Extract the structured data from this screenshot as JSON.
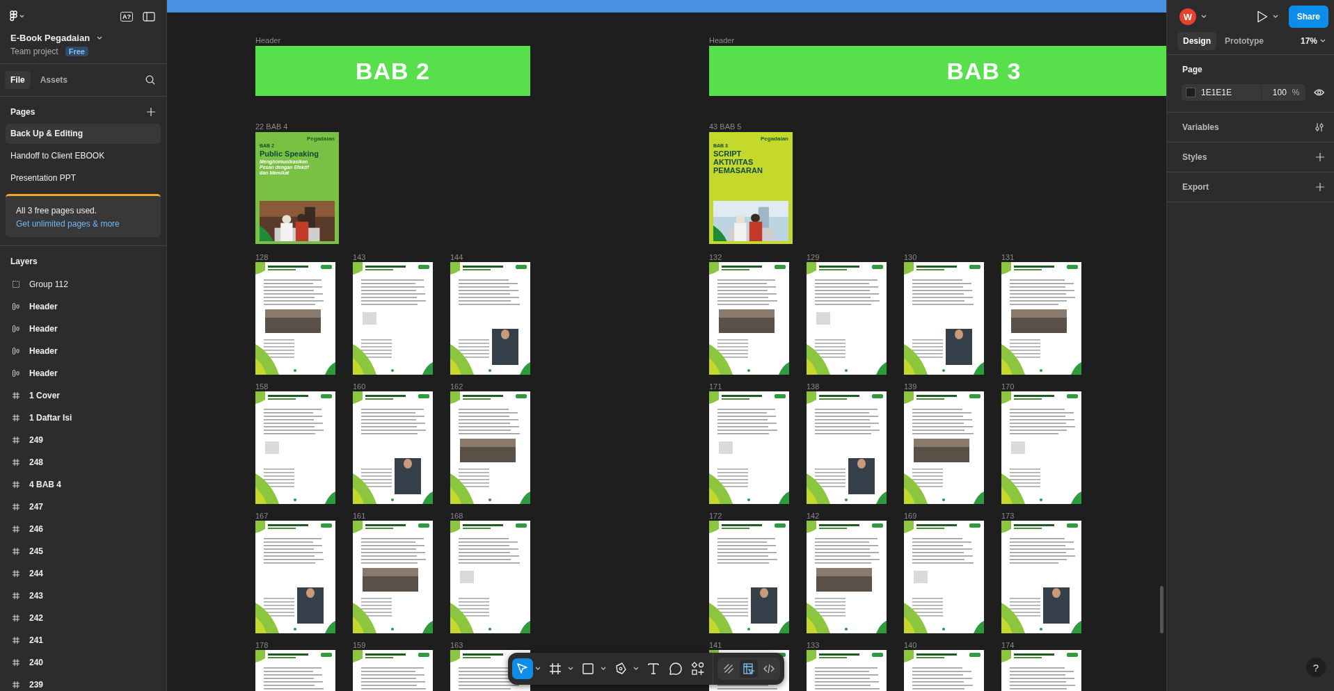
{
  "left_panel": {
    "project": {
      "name": "E-Book Pegadaian",
      "team": "Team project",
      "plan": "Free"
    },
    "ai_badge": "A?",
    "tabs": [
      {
        "label": "File",
        "selected": true
      },
      {
        "label": "Assets",
        "selected": false
      }
    ],
    "pages_title": "Pages",
    "pages": [
      {
        "label": "Back Up & Editing",
        "selected": true
      },
      {
        "label": "Handoff to Client EBOOK",
        "selected": false
      },
      {
        "label": "Presentation PPT",
        "selected": false
      }
    ],
    "notice": {
      "text": "All 3 free pages used.",
      "link": "Get unlimited pages & more"
    },
    "layers_title": "Layers",
    "layers": [
      {
        "kind": "group",
        "label": "Group 112"
      },
      {
        "kind": "autolayout",
        "label": "Header"
      },
      {
        "kind": "autolayout",
        "label": "Header"
      },
      {
        "kind": "autolayout",
        "label": "Header"
      },
      {
        "kind": "autolayout",
        "label": "Header"
      },
      {
        "kind": "frame",
        "label": "1 Cover"
      },
      {
        "kind": "frame",
        "label": "1 Daftar Isi"
      },
      {
        "kind": "frame",
        "label": "249"
      },
      {
        "kind": "frame",
        "label": "248"
      },
      {
        "kind": "frame",
        "label": "4 BAB 4"
      },
      {
        "kind": "frame",
        "label": "247"
      },
      {
        "kind": "frame",
        "label": "246"
      },
      {
        "kind": "frame",
        "label": "245"
      },
      {
        "kind": "frame",
        "label": "244"
      },
      {
        "kind": "frame",
        "label": "243"
      },
      {
        "kind": "frame",
        "label": "242"
      },
      {
        "kind": "frame",
        "label": "241"
      },
      {
        "kind": "frame",
        "label": "240"
      },
      {
        "kind": "frame",
        "label": "239"
      }
    ]
  },
  "canvas": {
    "sections": [
      {
        "header_label": "Header",
        "banner": "BAB 2",
        "cover_label": "22 BAB 4",
        "cover": {
          "color": "#7ac143",
          "brand": "Pegadaian",
          "tag": "BAB 2",
          "title": "Public Speaking",
          "subtitle": "Menghomunikasikan Pesan dengan Efektif dan Memikat"
        },
        "rows": [
          [
            "128",
            "143",
            "144"
          ],
          [
            "158",
            "160",
            "162"
          ],
          [
            "167",
            "161",
            "168"
          ],
          [
            "178",
            "159",
            "163"
          ]
        ]
      },
      {
        "header_label": "Header",
        "banner": "BAB 3",
        "cover_label": "43 BAB 5",
        "cover": {
          "color": "#c5d92d",
          "brand": "Pegadaian",
          "tag": "BAB 3",
          "title": "SCRIPT AKTIVITAS PEMASARAN"
        },
        "rows": [
          [
            "132",
            "129",
            "130",
            "131"
          ],
          [
            "171",
            "138",
            "139",
            "170"
          ],
          [
            "172",
            "142",
            "169",
            "173"
          ],
          [
            "141",
            "133",
            "140",
            "174"
          ]
        ]
      }
    ]
  },
  "toolbar": {
    "tools": [
      {
        "kind": "move",
        "selected": true
      },
      {
        "kind": "frame",
        "selected": false
      },
      {
        "kind": "shape",
        "selected": false
      },
      {
        "kind": "pen",
        "selected": false
      },
      {
        "kind": "text",
        "selected": false
      },
      {
        "kind": "comment",
        "selected": false
      },
      {
        "kind": "actions",
        "selected": false
      }
    ],
    "modes": [
      {
        "kind": "draw",
        "selected": false
      },
      {
        "kind": "design",
        "selected": true
      },
      {
        "kind": "dev",
        "selected": false
      }
    ]
  },
  "right_panel": {
    "avatar": "W",
    "share": "Share",
    "tabs": [
      {
        "label": "Design",
        "selected": true
      },
      {
        "label": "Prototype",
        "selected": false
      }
    ],
    "zoom": "17%",
    "page_section": {
      "title": "Page",
      "color": "#1e1e1e",
      "hex": "1E1E1E",
      "opacity": "100",
      "unit": "%"
    },
    "sections": [
      {
        "kind": "variables",
        "label": "Variables"
      },
      {
        "kind": "add",
        "label": "Styles"
      },
      {
        "kind": "add",
        "label": "Export"
      }
    ]
  },
  "help": "?"
}
